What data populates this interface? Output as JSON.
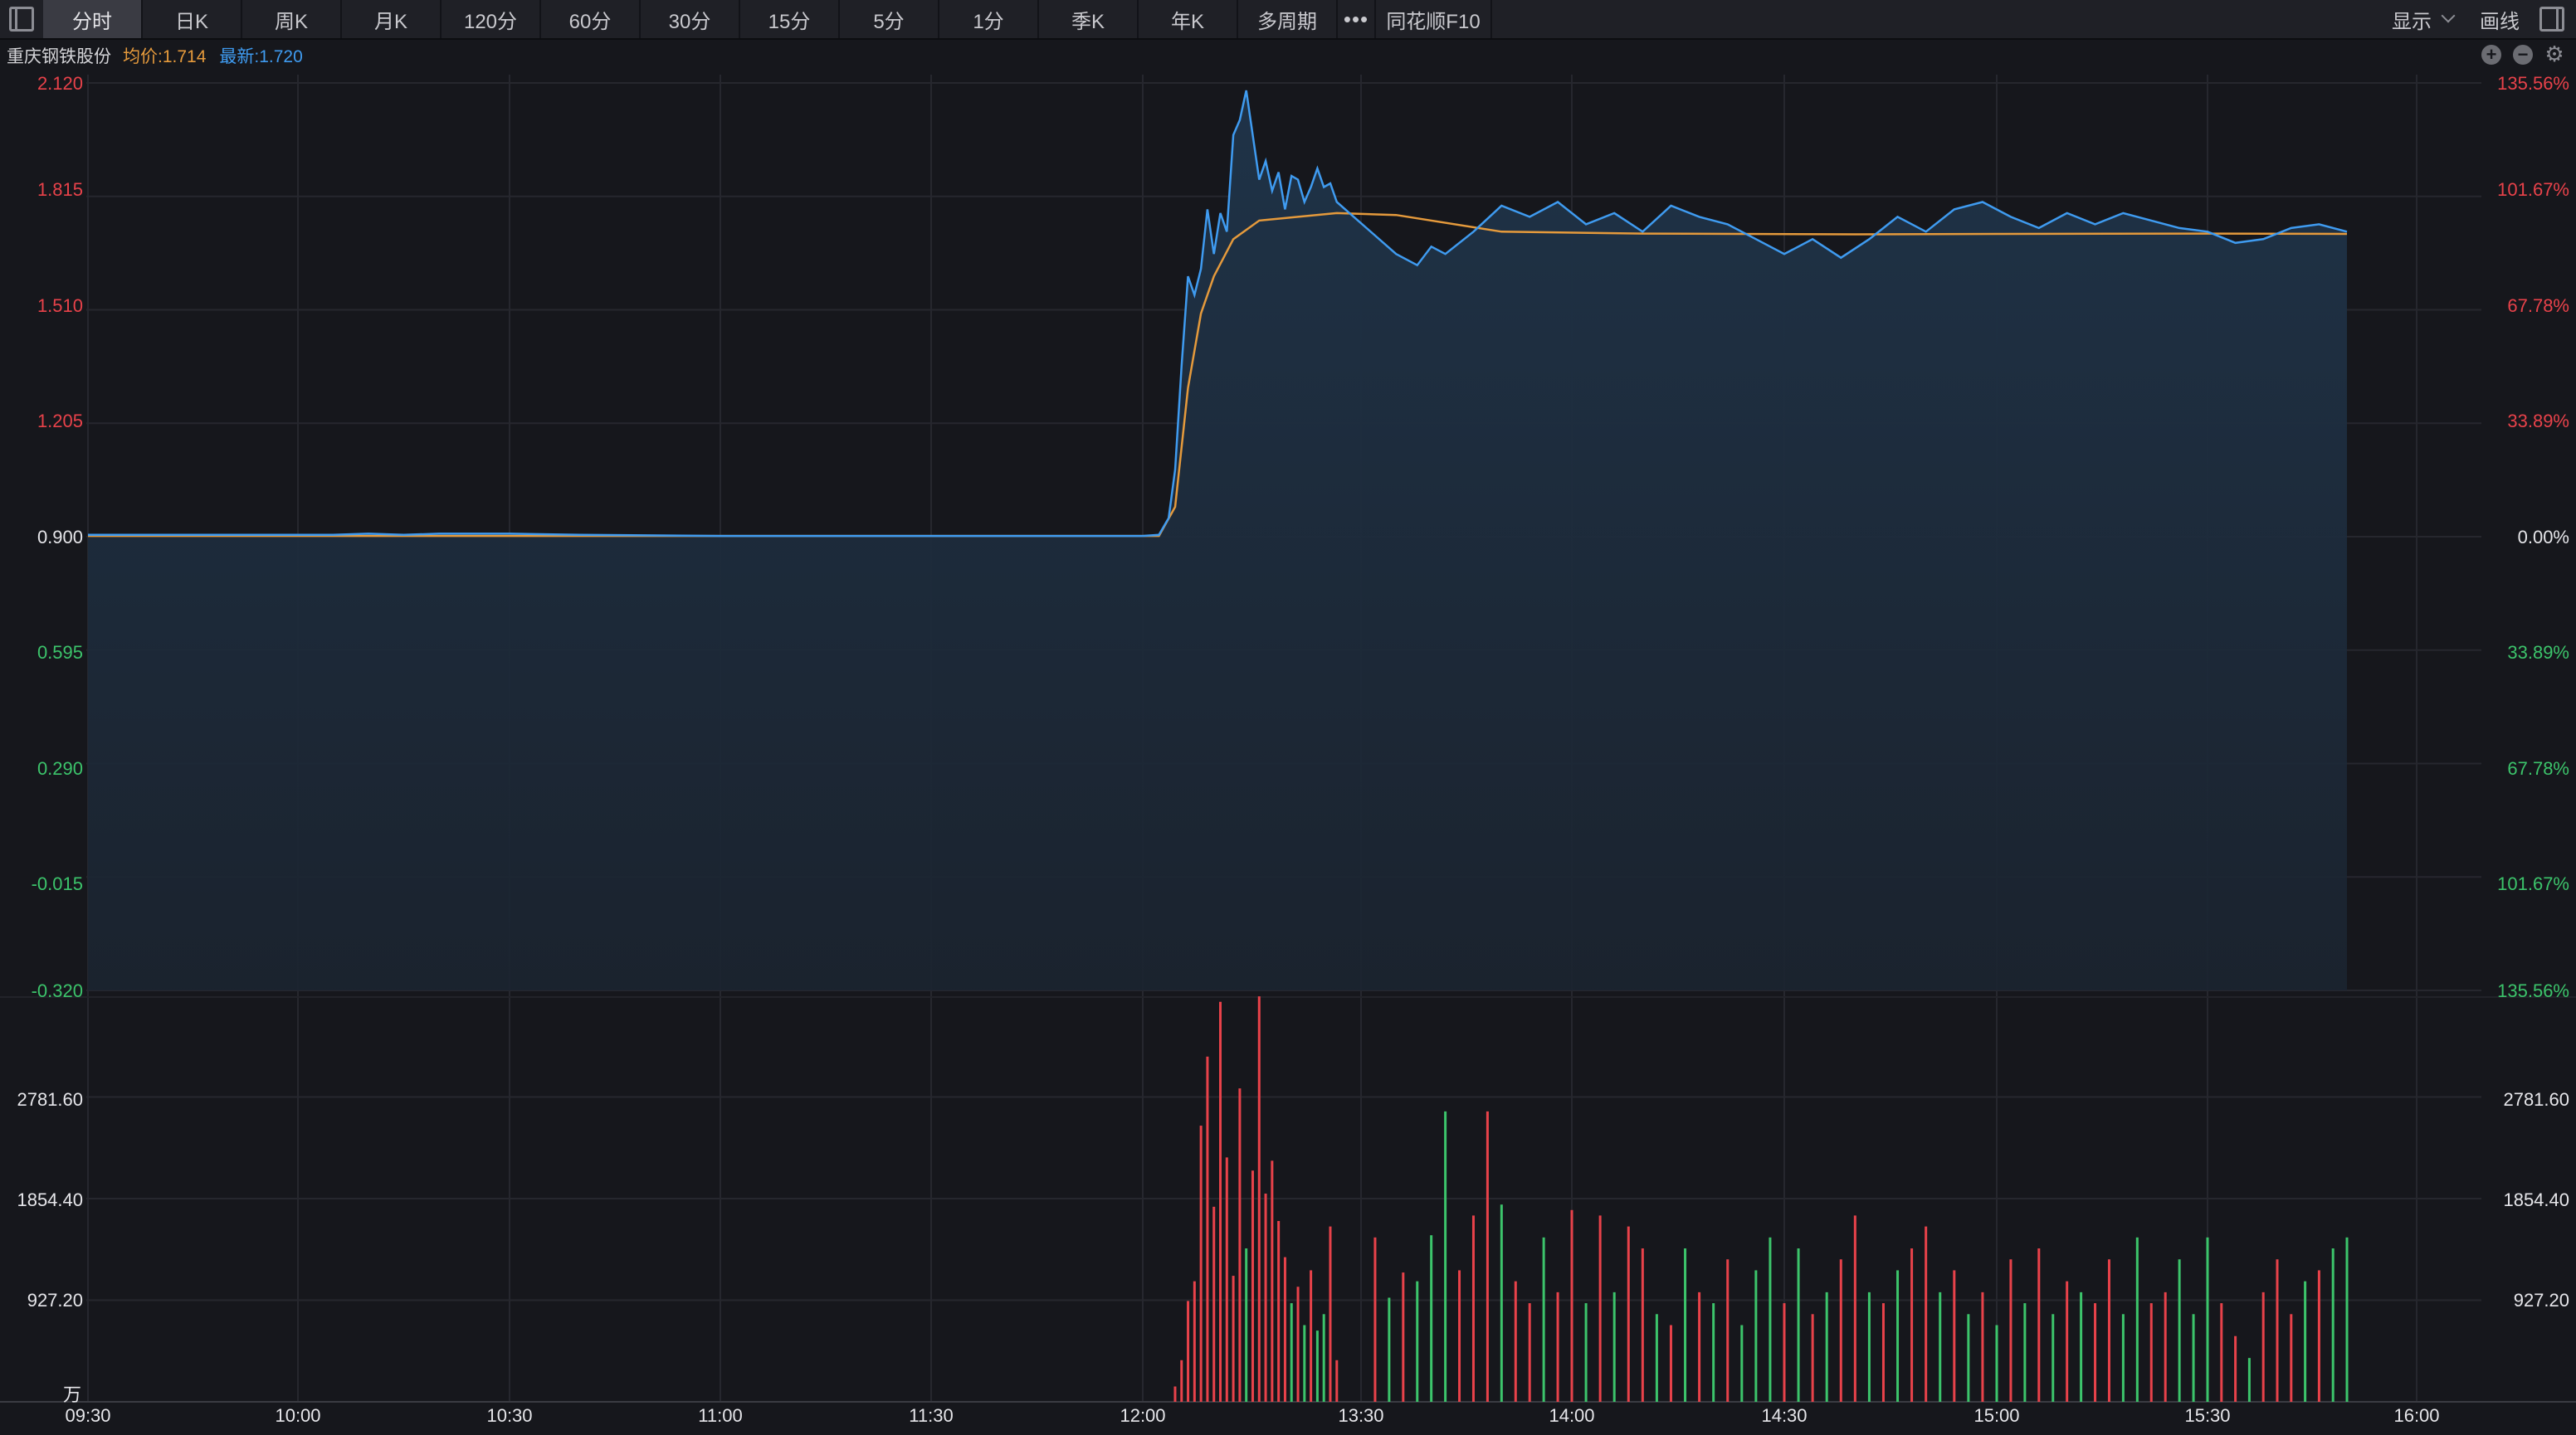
{
  "toolbar": {
    "tabs": [
      "分时",
      "日K",
      "周K",
      "月K",
      "120分",
      "60分",
      "30分",
      "15分",
      "5分",
      "1分",
      "季K",
      "年K",
      "多周期"
    ],
    "active_tab": "分时",
    "more_label": "•••",
    "f10_label": "同花顺F10",
    "display_label": "显示",
    "draw_label": "画线"
  },
  "info": {
    "stock_name": "重庆钢铁股份",
    "avg_label": "均价:1.714",
    "last_label": "最新:1.720"
  },
  "controls": {
    "zoom_in": "+",
    "zoom_out": "−",
    "settings": "⚙"
  },
  "price_axis": {
    "left": [
      "2.120",
      "1.815",
      "1.510",
      "1.205",
      "0.900",
      "0.595",
      "0.290",
      "-0.015",
      "-0.320"
    ],
    "right": [
      "135.56%",
      "101.67%",
      "67.78%",
      "33.89%",
      "0.00%",
      "33.89%",
      "67.78%",
      "101.67%",
      "135.56%"
    ]
  },
  "volume_axis": {
    "labels": [
      "2781.60",
      "1854.40",
      "927.20"
    ],
    "unit": "万"
  },
  "time_axis": [
    "09:30",
    "10:00",
    "10:30",
    "11:00",
    "11:30",
    "12:00",
    "13:30",
    "14:00",
    "14:30",
    "15:00",
    "15:30",
    "16:00"
  ],
  "colors": {
    "background": "#16171c",
    "price_line": "#3f9bf0",
    "avg_line": "#e59a3c",
    "up": "#e8424a",
    "down": "#3cc46b",
    "grid": "#26272e"
  },
  "chart_data": {
    "type": "line",
    "title": "",
    "prev_close": 0.9,
    "ylim": [
      -0.32,
      2.12
    ],
    "volume_ylim": [
      0,
      3708.8
    ],
    "series": [
      {
        "name": "最新",
        "points": [
          [
            "09:30",
            0.905
          ],
          [
            "09:45",
            0.905
          ],
          [
            "10:05",
            0.905
          ],
          [
            "10:10",
            0.908
          ],
          [
            "10:15",
            0.905
          ],
          [
            "10:20",
            0.908
          ],
          [
            "10:30",
            0.908
          ],
          [
            "10:40",
            0.905
          ],
          [
            "11:00",
            0.902
          ],
          [
            "11:30",
            0.902
          ],
          [
            "12:00",
            0.902
          ],
          [
            "12:05",
            0.905
          ],
          [
            "12:08",
            0.95
          ],
          [
            "12:10",
            1.08
          ],
          [
            "12:12",
            1.36
          ],
          [
            "12:14",
            1.6
          ],
          [
            "12:16",
            1.55
          ],
          [
            "12:18",
            1.62
          ],
          [
            "12:20",
            1.78
          ],
          [
            "12:22",
            1.66
          ],
          [
            "12:24",
            1.77
          ],
          [
            "12:26",
            1.72
          ],
          [
            "12:28",
            1.98
          ],
          [
            "12:30",
            2.02
          ],
          [
            "12:32",
            2.1
          ],
          [
            "12:34",
            1.98
          ],
          [
            "12:36",
            1.86
          ],
          [
            "12:38",
            1.91
          ],
          [
            "12:40",
            1.83
          ],
          [
            "12:42",
            1.88
          ],
          [
            "12:44",
            1.78
          ],
          [
            "12:46",
            1.87
          ],
          [
            "12:48",
            1.86
          ],
          [
            "12:50",
            1.8
          ],
          [
            "12:52",
            1.84
          ],
          [
            "12:54",
            1.89
          ],
          [
            "12:56",
            1.84
          ],
          [
            "12:58",
            1.85
          ],
          [
            "13:00",
            1.8
          ],
          [
            "13:35",
            1.66
          ],
          [
            "13:38",
            1.63
          ],
          [
            "13:40",
            1.68
          ],
          [
            "13:42",
            1.66
          ],
          [
            "13:46",
            1.72
          ],
          [
            "13:50",
            1.79
          ],
          [
            "13:54",
            1.76
          ],
          [
            "13:58",
            1.8
          ],
          [
            "14:02",
            1.74
          ],
          [
            "14:06",
            1.77
          ],
          [
            "14:10",
            1.72
          ],
          [
            "14:14",
            1.79
          ],
          [
            "14:18",
            1.76
          ],
          [
            "14:22",
            1.74
          ],
          [
            "14:26",
            1.7
          ],
          [
            "14:30",
            1.66
          ],
          [
            "14:34",
            1.7
          ],
          [
            "14:38",
            1.65
          ],
          [
            "14:42",
            1.7
          ],
          [
            "14:46",
            1.76
          ],
          [
            "14:50",
            1.72
          ],
          [
            "14:54",
            1.78
          ],
          [
            "14:58",
            1.8
          ],
          [
            "15:02",
            1.76
          ],
          [
            "15:06",
            1.73
          ],
          [
            "15:10",
            1.77
          ],
          [
            "15:14",
            1.74
          ],
          [
            "15:18",
            1.77
          ],
          [
            "15:22",
            1.75
          ],
          [
            "15:26",
            1.73
          ],
          [
            "15:30",
            1.72
          ],
          [
            "15:34",
            1.69
          ],
          [
            "15:38",
            1.7
          ],
          [
            "15:42",
            1.73
          ],
          [
            "15:46",
            1.74
          ],
          [
            "15:50",
            1.72
          ]
        ]
      },
      {
        "name": "均价",
        "points": [
          [
            "09:30",
            0.902
          ],
          [
            "12:05",
            0.902
          ],
          [
            "12:10",
            0.98
          ],
          [
            "12:14",
            1.3
          ],
          [
            "12:18",
            1.5
          ],
          [
            "12:22",
            1.6
          ],
          [
            "12:28",
            1.7
          ],
          [
            "12:36",
            1.75
          ],
          [
            "12:48",
            1.76
          ],
          [
            "13:00",
            1.77
          ],
          [
            "13:35",
            1.765
          ],
          [
            "13:50",
            1.72
          ],
          [
            "14:10",
            1.715
          ],
          [
            "14:40",
            1.713
          ],
          [
            "15:00",
            1.714
          ],
          [
            "15:30",
            1.715
          ],
          [
            "15:50",
            1.714
          ]
        ]
      }
    ],
    "volume": [
      [
        "12:10",
        140,
        "up"
      ],
      [
        "12:12",
        380,
        "up"
      ],
      [
        "12:14",
        920,
        "up"
      ],
      [
        "12:16",
        1100,
        "up"
      ],
      [
        "12:18",
        2520,
        "up"
      ],
      [
        "12:20",
        3150,
        "up"
      ],
      [
        "12:22",
        1780,
        "up"
      ],
      [
        "12:24",
        3650,
        "up"
      ],
      [
        "12:26",
        2230,
        "up"
      ],
      [
        "12:28",
        1150,
        "up"
      ],
      [
        "12:30",
        2860,
        "up"
      ],
      [
        "12:32",
        1400,
        "down"
      ],
      [
        "12:34",
        2110,
        "up"
      ],
      [
        "12:36",
        3700,
        "up"
      ],
      [
        "12:38",
        1900,
        "up"
      ],
      [
        "12:40",
        2200,
        "up"
      ],
      [
        "12:42",
        1650,
        "up"
      ],
      [
        "12:44",
        1320,
        "up"
      ],
      [
        "12:46",
        900,
        "down"
      ],
      [
        "12:48",
        1050,
        "up"
      ],
      [
        "12:50",
        700,
        "down"
      ],
      [
        "12:52",
        1200,
        "up"
      ],
      [
        "12:54",
        650,
        "down"
      ],
      [
        "12:56",
        800,
        "down"
      ],
      [
        "12:58",
        1600,
        "up"
      ],
      [
        "13:00",
        380,
        "up"
      ],
      [
        "13:32",
        1500,
        "up"
      ],
      [
        "13:34",
        950,
        "down"
      ],
      [
        "13:36",
        1180,
        "up"
      ],
      [
        "13:38",
        1100,
        "down"
      ],
      [
        "13:40",
        1520,
        "down"
      ],
      [
        "13:42",
        2650,
        "down"
      ],
      [
        "13:44",
        1200,
        "up"
      ],
      [
        "13:46",
        1700,
        "up"
      ],
      [
        "13:48",
        2650,
        "up"
      ],
      [
        "13:50",
        1800,
        "down"
      ],
      [
        "13:52",
        1100,
        "up"
      ],
      [
        "13:54",
        900,
        "up"
      ],
      [
        "13:56",
        1500,
        "down"
      ],
      [
        "13:58",
        1000,
        "up"
      ],
      [
        "14:00",
        1750,
        "up"
      ],
      [
        "14:02",
        900,
        "down"
      ],
      [
        "14:04",
        1700,
        "up"
      ],
      [
        "14:06",
        1000,
        "down"
      ],
      [
        "14:08",
        1600,
        "up"
      ],
      [
        "14:10",
        1400,
        "up"
      ],
      [
        "14:12",
        800,
        "down"
      ],
      [
        "14:14",
        700,
        "up"
      ],
      [
        "14:16",
        1400,
        "down"
      ],
      [
        "14:18",
        1000,
        "up"
      ],
      [
        "14:20",
        900,
        "down"
      ],
      [
        "14:22",
        1300,
        "up"
      ],
      [
        "14:24",
        700,
        "down"
      ],
      [
        "14:26",
        1200,
        "down"
      ],
      [
        "14:28",
        1500,
        "down"
      ],
      [
        "14:30",
        900,
        "up"
      ],
      [
        "14:32",
        1400,
        "down"
      ],
      [
        "14:34",
        800,
        "up"
      ],
      [
        "14:36",
        1000,
        "down"
      ],
      [
        "14:38",
        1300,
        "up"
      ],
      [
        "14:40",
        1700,
        "up"
      ],
      [
        "14:42",
        1000,
        "down"
      ],
      [
        "14:44",
        900,
        "up"
      ],
      [
        "14:46",
        1200,
        "down"
      ],
      [
        "14:48",
        1400,
        "up"
      ],
      [
        "14:50",
        1600,
        "up"
      ],
      [
        "14:52",
        1000,
        "down"
      ],
      [
        "14:54",
        1200,
        "up"
      ],
      [
        "14:56",
        800,
        "down"
      ],
      [
        "14:58",
        1000,
        "up"
      ],
      [
        "15:00",
        700,
        "down"
      ],
      [
        "15:02",
        1300,
        "up"
      ],
      [
        "15:04",
        900,
        "down"
      ],
      [
        "15:06",
        1400,
        "up"
      ],
      [
        "15:08",
        800,
        "down"
      ],
      [
        "15:10",
        1100,
        "up"
      ],
      [
        "15:12",
        1000,
        "down"
      ],
      [
        "15:14",
        900,
        "up"
      ],
      [
        "15:16",
        1300,
        "up"
      ],
      [
        "15:18",
        800,
        "down"
      ],
      [
        "15:20",
        1500,
        "down"
      ],
      [
        "15:22",
        900,
        "up"
      ],
      [
        "15:24",
        1000,
        "up"
      ],
      [
        "15:26",
        1300,
        "down"
      ],
      [
        "15:28",
        800,
        "down"
      ],
      [
        "15:30",
        1500,
        "down"
      ],
      [
        "15:32",
        900,
        "up"
      ],
      [
        "15:34",
        600,
        "up"
      ],
      [
        "15:36",
        400,
        "down"
      ],
      [
        "15:38",
        1000,
        "up"
      ],
      [
        "15:40",
        1300,
        "up"
      ],
      [
        "15:42",
        800,
        "up"
      ],
      [
        "15:44",
        1100,
        "down"
      ],
      [
        "15:46",
        1200,
        "up"
      ],
      [
        "15:48",
        1400,
        "down"
      ],
      [
        "15:50",
        1500,
        "down"
      ]
    ]
  }
}
